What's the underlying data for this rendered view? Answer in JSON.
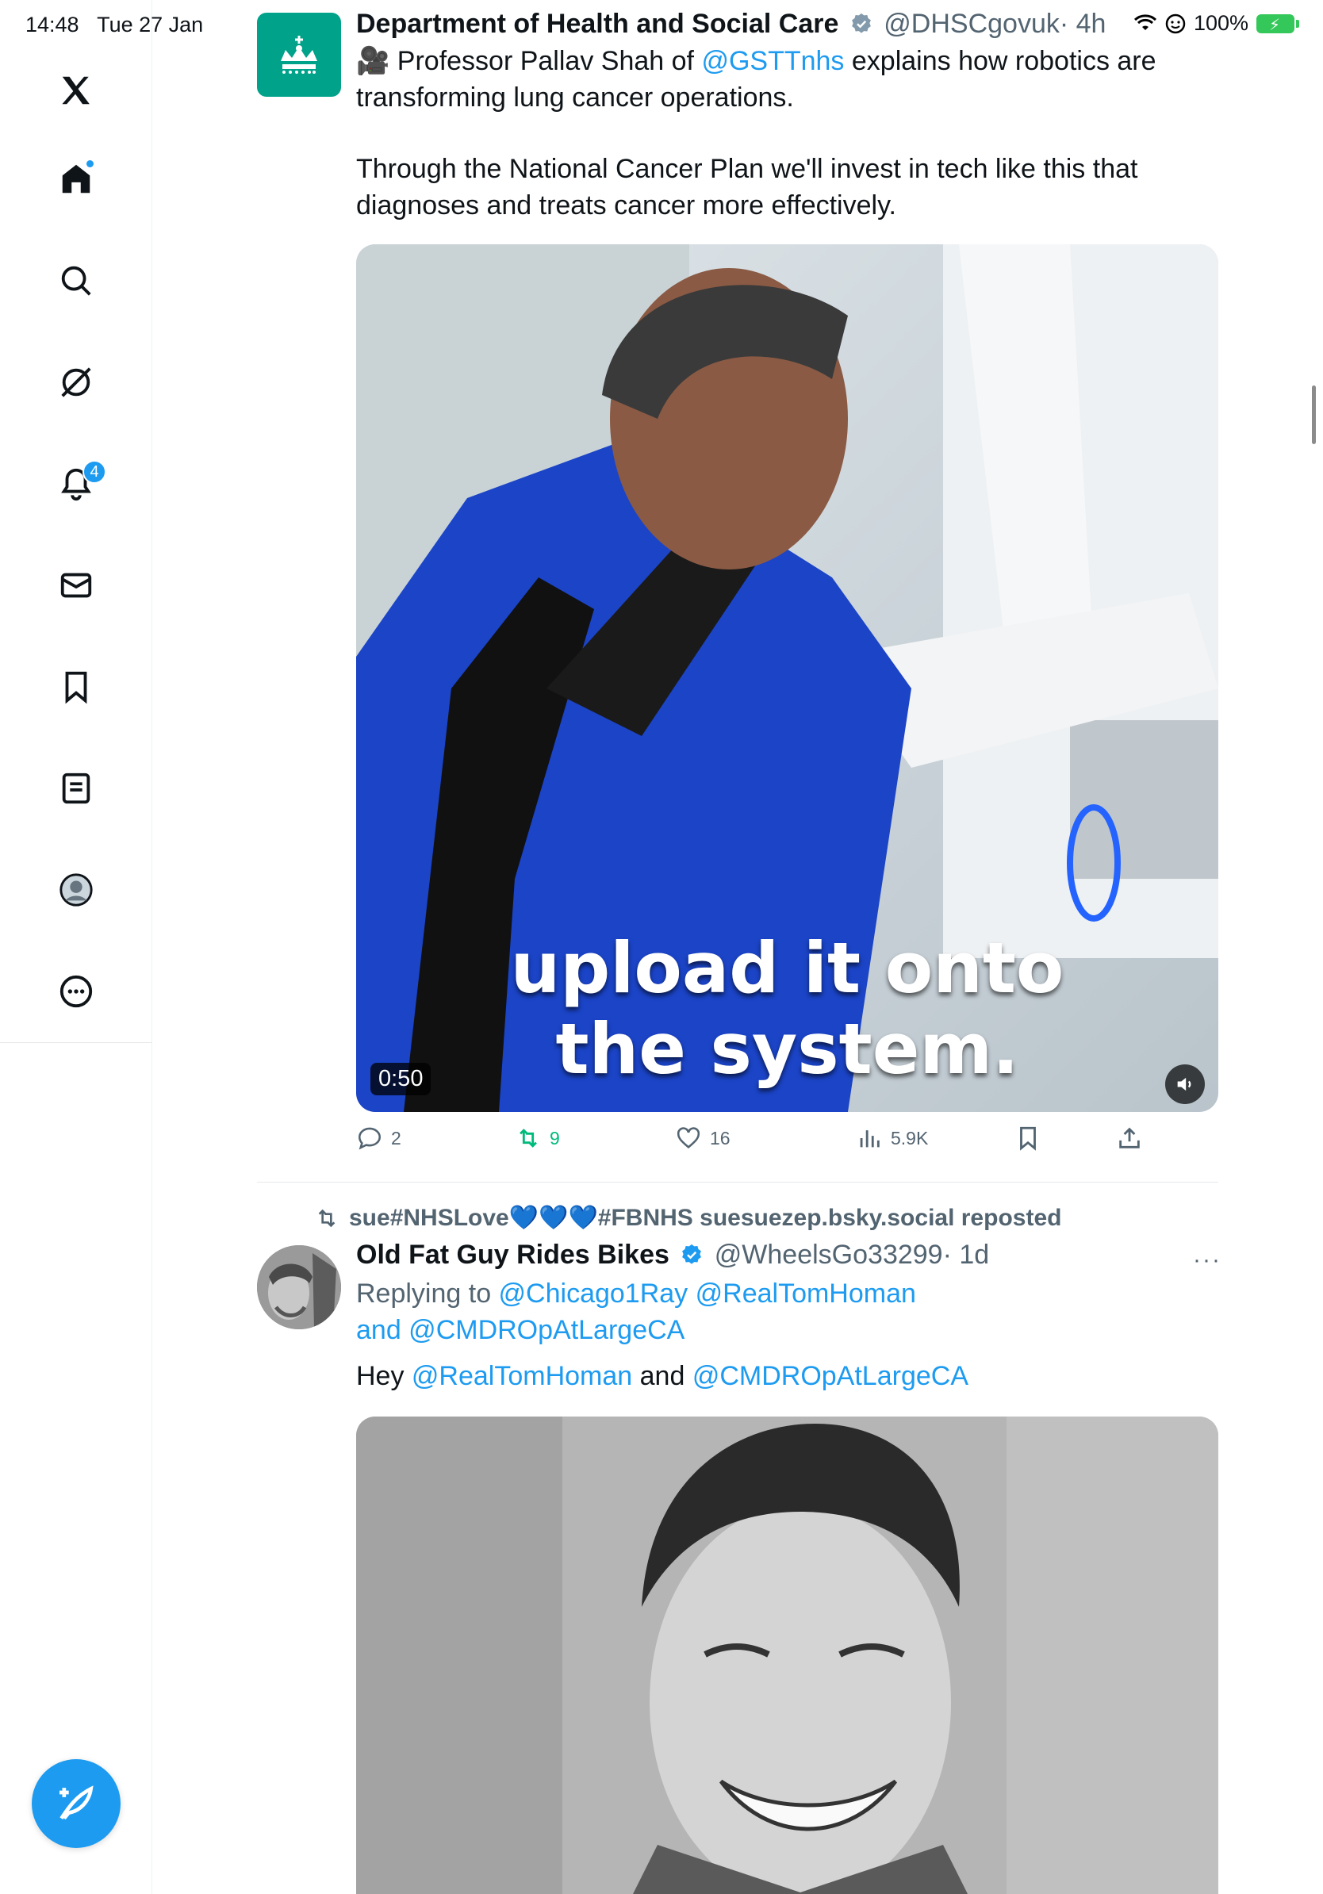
{
  "status_bar": {
    "time": "14:48",
    "date": "Tue 27 Jan",
    "battery_text": "100%",
    "battery_color": "#34c759"
  },
  "sidebar": {
    "items": [
      {
        "name": "x-logo-icon"
      },
      {
        "name": "home-icon",
        "has_dot": true
      },
      {
        "name": "search-icon"
      },
      {
        "name": "grok-icon"
      },
      {
        "name": "notifications-icon",
        "badge": "4"
      },
      {
        "name": "messages-icon"
      },
      {
        "name": "bookmarks-icon"
      },
      {
        "name": "lists-icon"
      },
      {
        "name": "profile-icon"
      },
      {
        "name": "more-icon"
      }
    ],
    "compose_icon": "compose-feather-icon",
    "accent": "#1d9bf0"
  },
  "tweets": [
    {
      "author_name": "Department of Health and Social Care",
      "handle": "@DHSCgovuk",
      "time": "· 4h",
      "text_prefix": "🎥 Professor Pallav Shah of ",
      "mention": "@GSTTnhs",
      "text_suffix": " explains how robotics are transforming lung cancer operations.",
      "text_2": "Through the National Cancer Plan we'll invest in tech like this that diagnoses and treats cancer more effectively.",
      "video_caption_line1": "upload it onto",
      "video_caption_line2": "the system.",
      "video_duration": "0:50",
      "replies": "2",
      "reposts": "9",
      "likes": "16",
      "views": "5.9K",
      "repost_color": "#00ba7c",
      "avatar_color": "#00a28a"
    },
    {
      "reposted_by": "sue#NHSLove💙💙💙#FBNHS suesuezep.bsky.social reposted",
      "author_name": "Old Fat Guy Rides Bikes",
      "handle": "@WheelsGo33299",
      "time": "· 1d",
      "replying_prefix": "Replying to ",
      "replying_mentions": "@Chicago1Ray @RealTomHoman and @CMDROpAtLargeCA",
      "text_hey": "Hey ",
      "mention_1": "@RealTomHoman",
      "text_and": " and ",
      "mention_2": "@CMDROpAtLargeCA",
      "more_label": "···"
    }
  ]
}
